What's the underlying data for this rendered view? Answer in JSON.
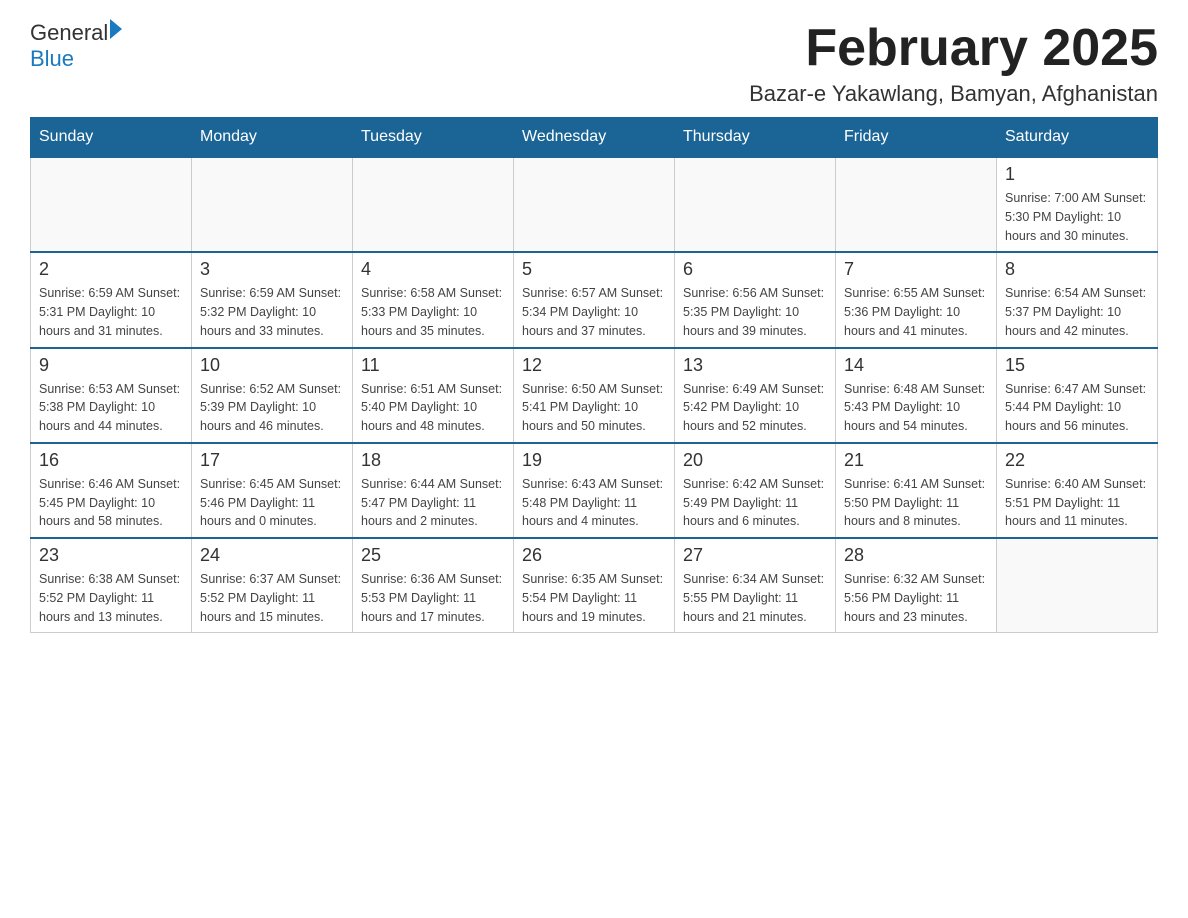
{
  "header": {
    "logo_general": "General",
    "logo_blue": "Blue",
    "title": "February 2025",
    "subtitle": "Bazar-e Yakawlang, Bamyan, Afghanistan"
  },
  "days_of_week": [
    "Sunday",
    "Monday",
    "Tuesday",
    "Wednesday",
    "Thursday",
    "Friday",
    "Saturday"
  ],
  "weeks": [
    {
      "days": [
        {
          "num": "",
          "info": ""
        },
        {
          "num": "",
          "info": ""
        },
        {
          "num": "",
          "info": ""
        },
        {
          "num": "",
          "info": ""
        },
        {
          "num": "",
          "info": ""
        },
        {
          "num": "",
          "info": ""
        },
        {
          "num": "1",
          "info": "Sunrise: 7:00 AM\nSunset: 5:30 PM\nDaylight: 10 hours and 30 minutes."
        }
      ]
    },
    {
      "days": [
        {
          "num": "2",
          "info": "Sunrise: 6:59 AM\nSunset: 5:31 PM\nDaylight: 10 hours and 31 minutes."
        },
        {
          "num": "3",
          "info": "Sunrise: 6:59 AM\nSunset: 5:32 PM\nDaylight: 10 hours and 33 minutes."
        },
        {
          "num": "4",
          "info": "Sunrise: 6:58 AM\nSunset: 5:33 PM\nDaylight: 10 hours and 35 minutes."
        },
        {
          "num": "5",
          "info": "Sunrise: 6:57 AM\nSunset: 5:34 PM\nDaylight: 10 hours and 37 minutes."
        },
        {
          "num": "6",
          "info": "Sunrise: 6:56 AM\nSunset: 5:35 PM\nDaylight: 10 hours and 39 minutes."
        },
        {
          "num": "7",
          "info": "Sunrise: 6:55 AM\nSunset: 5:36 PM\nDaylight: 10 hours and 41 minutes."
        },
        {
          "num": "8",
          "info": "Sunrise: 6:54 AM\nSunset: 5:37 PM\nDaylight: 10 hours and 42 minutes."
        }
      ]
    },
    {
      "days": [
        {
          "num": "9",
          "info": "Sunrise: 6:53 AM\nSunset: 5:38 PM\nDaylight: 10 hours and 44 minutes."
        },
        {
          "num": "10",
          "info": "Sunrise: 6:52 AM\nSunset: 5:39 PM\nDaylight: 10 hours and 46 minutes."
        },
        {
          "num": "11",
          "info": "Sunrise: 6:51 AM\nSunset: 5:40 PM\nDaylight: 10 hours and 48 minutes."
        },
        {
          "num": "12",
          "info": "Sunrise: 6:50 AM\nSunset: 5:41 PM\nDaylight: 10 hours and 50 minutes."
        },
        {
          "num": "13",
          "info": "Sunrise: 6:49 AM\nSunset: 5:42 PM\nDaylight: 10 hours and 52 minutes."
        },
        {
          "num": "14",
          "info": "Sunrise: 6:48 AM\nSunset: 5:43 PM\nDaylight: 10 hours and 54 minutes."
        },
        {
          "num": "15",
          "info": "Sunrise: 6:47 AM\nSunset: 5:44 PM\nDaylight: 10 hours and 56 minutes."
        }
      ]
    },
    {
      "days": [
        {
          "num": "16",
          "info": "Sunrise: 6:46 AM\nSunset: 5:45 PM\nDaylight: 10 hours and 58 minutes."
        },
        {
          "num": "17",
          "info": "Sunrise: 6:45 AM\nSunset: 5:46 PM\nDaylight: 11 hours and 0 minutes."
        },
        {
          "num": "18",
          "info": "Sunrise: 6:44 AM\nSunset: 5:47 PM\nDaylight: 11 hours and 2 minutes."
        },
        {
          "num": "19",
          "info": "Sunrise: 6:43 AM\nSunset: 5:48 PM\nDaylight: 11 hours and 4 minutes."
        },
        {
          "num": "20",
          "info": "Sunrise: 6:42 AM\nSunset: 5:49 PM\nDaylight: 11 hours and 6 minutes."
        },
        {
          "num": "21",
          "info": "Sunrise: 6:41 AM\nSunset: 5:50 PM\nDaylight: 11 hours and 8 minutes."
        },
        {
          "num": "22",
          "info": "Sunrise: 6:40 AM\nSunset: 5:51 PM\nDaylight: 11 hours and 11 minutes."
        }
      ]
    },
    {
      "days": [
        {
          "num": "23",
          "info": "Sunrise: 6:38 AM\nSunset: 5:52 PM\nDaylight: 11 hours and 13 minutes."
        },
        {
          "num": "24",
          "info": "Sunrise: 6:37 AM\nSunset: 5:52 PM\nDaylight: 11 hours and 15 minutes."
        },
        {
          "num": "25",
          "info": "Sunrise: 6:36 AM\nSunset: 5:53 PM\nDaylight: 11 hours and 17 minutes."
        },
        {
          "num": "26",
          "info": "Sunrise: 6:35 AM\nSunset: 5:54 PM\nDaylight: 11 hours and 19 minutes."
        },
        {
          "num": "27",
          "info": "Sunrise: 6:34 AM\nSunset: 5:55 PM\nDaylight: 11 hours and 21 minutes."
        },
        {
          "num": "28",
          "info": "Sunrise: 6:32 AM\nSunset: 5:56 PM\nDaylight: 11 hours and 23 minutes."
        },
        {
          "num": "",
          "info": ""
        }
      ]
    }
  ]
}
